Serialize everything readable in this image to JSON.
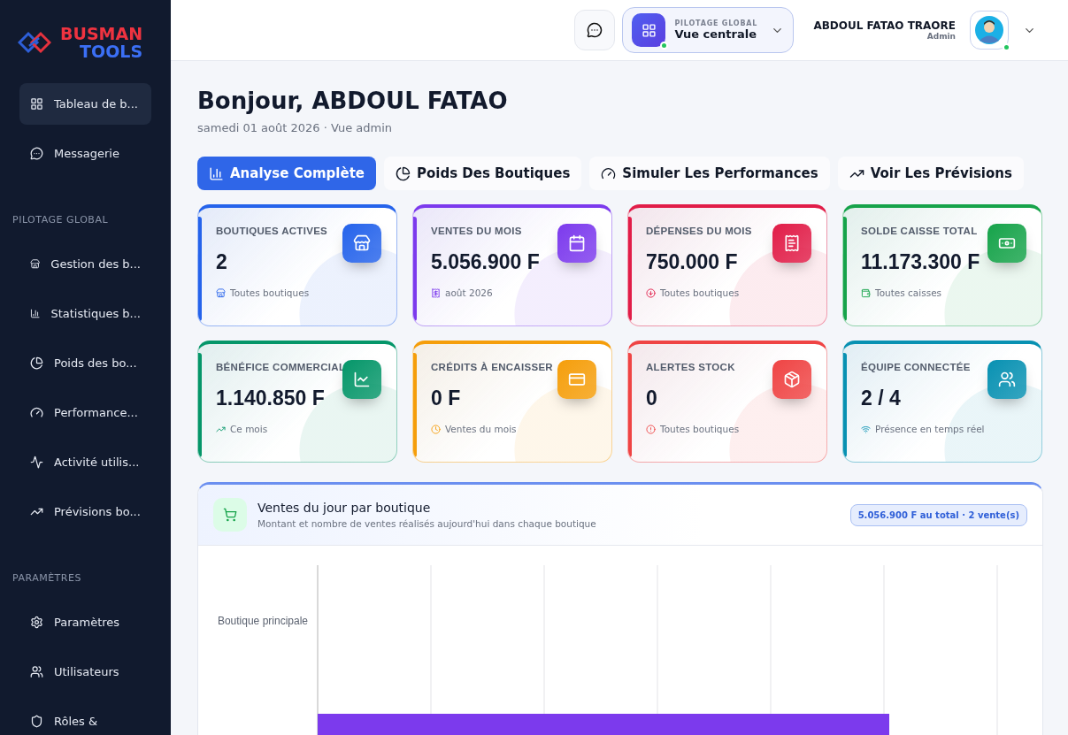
{
  "brand": {
    "line1": "BUSMAN",
    "line2": "TOOLS"
  },
  "sidebar": {
    "sections": [
      {
        "items": [
          {
            "label": "Tableau de b...",
            "selected": true
          },
          {
            "label": "Messagerie",
            "selected": false
          }
        ]
      },
      {
        "title": "PILOTAGE GLOBAL",
        "items": [
          {
            "label": "Gestion des b...",
            "selected": false
          },
          {
            "label": "Statistiques b...",
            "selected": false
          },
          {
            "label": "Poids des bo...",
            "selected": false
          },
          {
            "label": "Performance...",
            "selected": false
          },
          {
            "label": "Activité utilis...",
            "selected": false
          },
          {
            "label": "Prévisions bo...",
            "selected": false
          }
        ]
      },
      {
        "title": "PARAMÈTRES",
        "items": [
          {
            "label": "Paramètres",
            "selected": false
          },
          {
            "label": "Utilisateurs",
            "selected": false
          },
          {
            "label": "Rôles &",
            "selected": false
          }
        ]
      }
    ]
  },
  "header": {
    "scope": {
      "caption": "PILOTAGE GLOBAL",
      "value": "Vue centrale",
      "online": true
    },
    "user": {
      "name": "ABDOUL FATAO TRAORE",
      "role": "Admin",
      "online": true
    }
  },
  "greeting": {
    "title": "Bonjour, ABDOUL FATAO",
    "subtitle": "samedi 01 août 2026 · Vue admin"
  },
  "tabs": [
    {
      "label": "Analyse Complète",
      "selected": true
    },
    {
      "label": "Poids Des Boutiques",
      "selected": false
    },
    {
      "label": "Simuler Les Performances",
      "selected": false
    },
    {
      "label": "Voir Les Prévisions",
      "selected": false
    }
  ],
  "stats": [
    {
      "label": "BOUTIQUES ACTIVES",
      "value": "2",
      "note": "Toutes boutiques",
      "color": "#2563eb"
    },
    {
      "label": "VENTES DU MOIS",
      "value": "5.056.900 F",
      "note": "août 2026",
      "color": "#7c3aed"
    },
    {
      "label": "DÉPENSES DU MOIS",
      "value": "750.000 F",
      "note": "Toutes boutiques",
      "color": "#e11d48"
    },
    {
      "label": "SOLDE CAISSE TOTAL",
      "value": "11.173.300 F",
      "note": "Toutes caisses",
      "color": "#16a34a"
    },
    {
      "label": "BÉNÉFICE COMMERCIAL",
      "value": "1.140.850 F",
      "note": "Ce mois",
      "color": "#059669"
    },
    {
      "label": "CRÉDITS À ENCAISSER",
      "value": "0 F",
      "note": "Ventes du mois",
      "color": "#f59e0b"
    },
    {
      "label": "ALERTES STOCK",
      "value": "0",
      "note": "Toutes boutiques",
      "color": "#ef4444"
    },
    {
      "label": "ÉQUIPE CONNECTÉE",
      "value": "2 / 4",
      "note": "Présence en temps réel",
      "color": "#0891b2"
    }
  ],
  "sales_panel": {
    "title": "Ventes du jour par boutique",
    "subtitle": "Montant et nombre de ventes réalisés aujourd'hui dans chaque boutique",
    "badge": "5.056.900 F au total · 2 vente(s)",
    "category": "Boutique principale"
  }
}
